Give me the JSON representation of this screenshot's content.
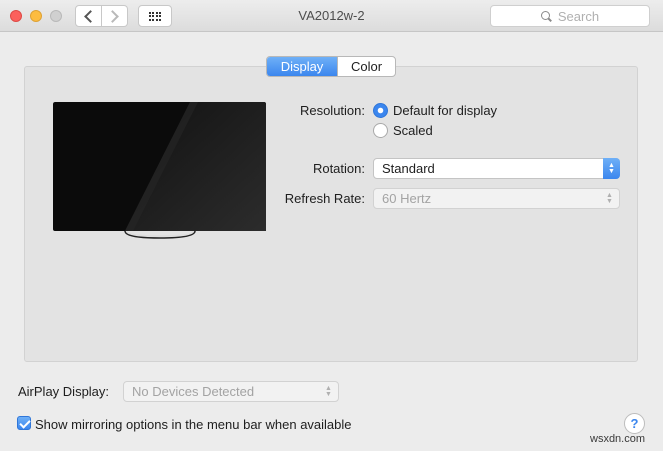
{
  "window": {
    "title": "VA2012w-2",
    "search_placeholder": "Search"
  },
  "tabs": [
    {
      "label": "Display",
      "selected": true
    },
    {
      "label": "Color",
      "selected": false
    }
  ],
  "display": {
    "resolution_label": "Resolution:",
    "resolution_options": [
      {
        "label": "Default for display",
        "selected": true
      },
      {
        "label": "Scaled",
        "selected": false
      }
    ],
    "rotation_label": "Rotation:",
    "rotation_value": "Standard",
    "refresh_label": "Refresh Rate:",
    "refresh_value": "60 Hertz"
  },
  "airplay": {
    "label": "AirPlay Display:",
    "value": "No Devices Detected"
  },
  "mirroring": {
    "label": "Show mirroring options in the menu bar when available",
    "checked": true
  },
  "help_label": "?",
  "watermark": "wsxdn.com",
  "colors": {
    "accent": "#3b86ee",
    "window_bg": "#ececec",
    "panel_bg": "#e3e3e3"
  },
  "icons": {
    "back": "chevron-left-icon",
    "forward": "chevron-right-icon",
    "show_all": "grid-icon",
    "search": "search-icon",
    "monitor": "monitor-icon"
  }
}
